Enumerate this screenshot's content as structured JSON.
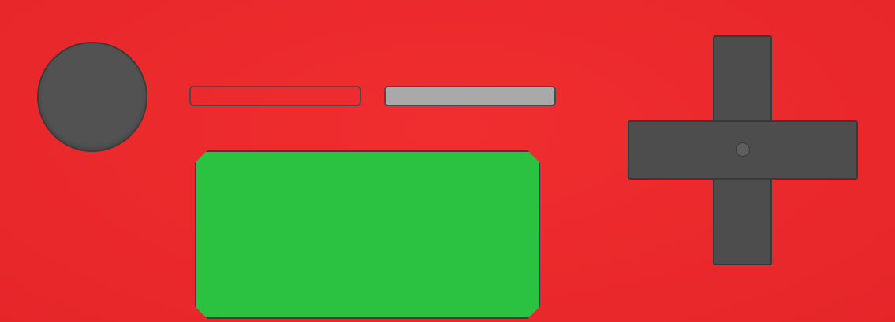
{
  "colors": {
    "body": "#ec2b2d",
    "button": "#525252",
    "screen": "#2bc141",
    "start_pill": "#a9a9a9",
    "dpad": "#4d4d4d"
  },
  "controls": {
    "action_button": "round-button",
    "select_button": "outline-pill",
    "start_button": "filled-pill",
    "dpad": "cross-pad"
  }
}
